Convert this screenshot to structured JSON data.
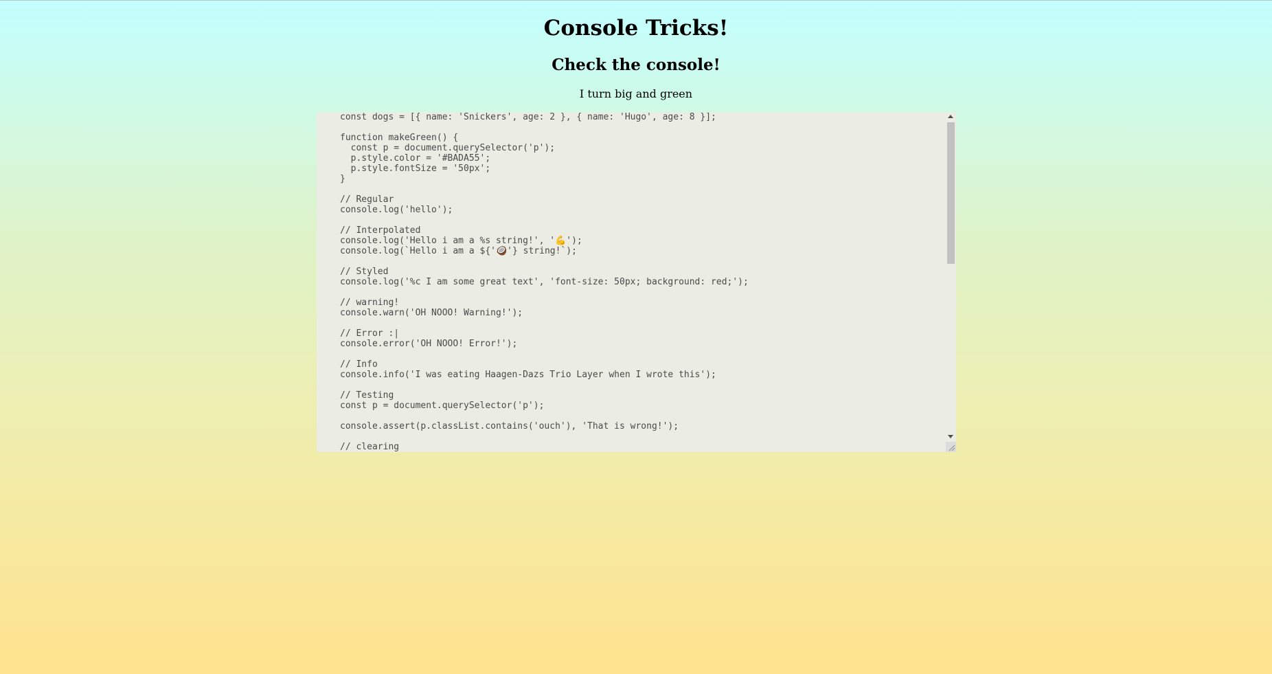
{
  "page": {
    "title": "Console Tricks!",
    "subtitle": "Check the console!",
    "paragraph": "I turn big and green"
  },
  "editor": {
    "lines": [
      "const dogs = [{ name: 'Snickers', age: 2 }, { name: 'Hugo', age: 8 }];",
      "",
      "function makeGreen() {",
      "  const p = document.querySelector('p');",
      "  p.style.color = '#BADA55';",
      "  p.style.fontSize = '50px';",
      "}",
      "",
      "// Regular",
      "console.log('hello');",
      "",
      "// Interpolated",
      "console.log('Hello i am a %s string!', '💪');",
      "console.log(`Hello i am a ${'🥥'} string!`);",
      "",
      "// Styled",
      "console.log('%c I am some great text', 'font-size: 50px; background: red;');",
      "",
      "// warning!",
      "console.warn('OH NOOO! Warning!');",
      "",
      "// Error :|",
      "console.error('OH NOOO! Error!');",
      "",
      "// Info",
      "console.info('I was eating Haagen-Dazs Trio Layer when I wrote this');",
      "",
      "// Testing",
      "const p = document.querySelector('p');",
      "",
      "console.assert(p.classList.contains('ouch'), 'That is wrong!');",
      "",
      "// clearing"
    ]
  },
  "colors": {
    "background_top": "#c2ffff",
    "background_bottom": "#ffe28e",
    "editor_background": "#ebece4",
    "code_text": "#4a4a4a",
    "scrollbar_thumb": "#c1c1c1"
  }
}
